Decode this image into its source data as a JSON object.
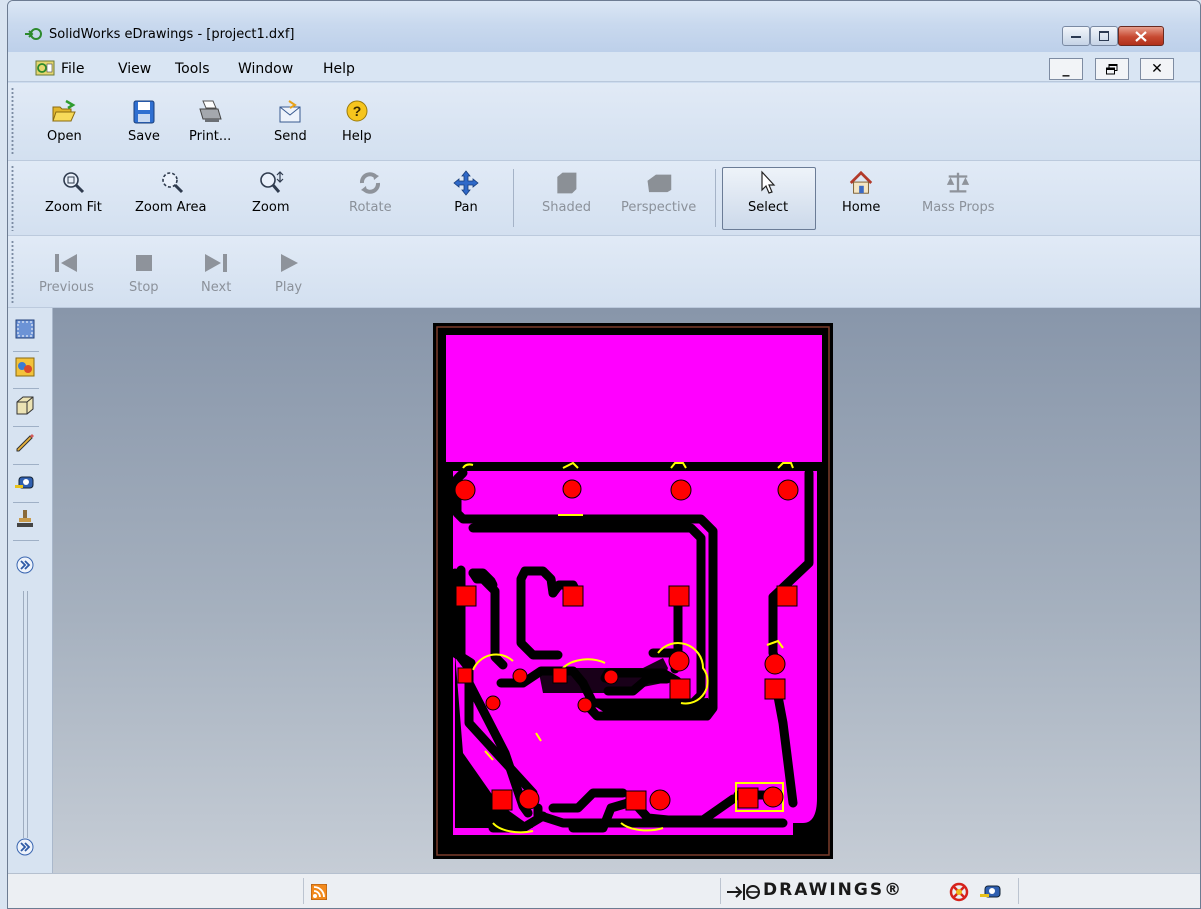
{
  "window": {
    "title": "SolidWorks eDrawings - [project1.dxf]"
  },
  "menubar": {
    "items": [
      "File",
      "View",
      "Tools",
      "Window",
      "Help"
    ],
    "mdi_min": "_",
    "mdi_restore": "🗗",
    "mdi_close": "✕"
  },
  "toolbar_file": {
    "open": "Open",
    "save": "Save",
    "print": "Print...",
    "send": "Send",
    "help": "Help"
  },
  "toolbar_view": {
    "zoom_fit": "Zoom Fit",
    "zoom_area": "Zoom Area",
    "zoom": "Zoom",
    "rotate": "Rotate",
    "pan": "Pan",
    "shaded": "Shaded",
    "perspective": "Perspective",
    "select": "Select",
    "home": "Home",
    "mass_props": "Mass Props"
  },
  "toolbar_animation": {
    "previous": "Previous",
    "stop": "Stop",
    "next": "Next",
    "play": "Play"
  },
  "statusbar": {
    "brand": "DRAWINGS®"
  },
  "colors": {
    "board": "#ff00ff",
    "copper": "#ff0000",
    "silkscreen": "#ffff00",
    "background_top": "#8896aa"
  },
  "icons": [
    "open-folder-icon",
    "save-disk-icon",
    "printer-icon",
    "send-envelope-icon",
    "help-question-icon",
    "zoom-fit-icon",
    "zoom-area-icon",
    "zoom-icon",
    "rotate-icon",
    "pan-arrows-icon",
    "shaded-cube-icon",
    "perspective-cube-icon",
    "select-cursor-icon",
    "home-icon",
    "mass-props-scale-icon",
    "previous-icon",
    "stop-icon",
    "next-icon",
    "play-icon"
  ]
}
